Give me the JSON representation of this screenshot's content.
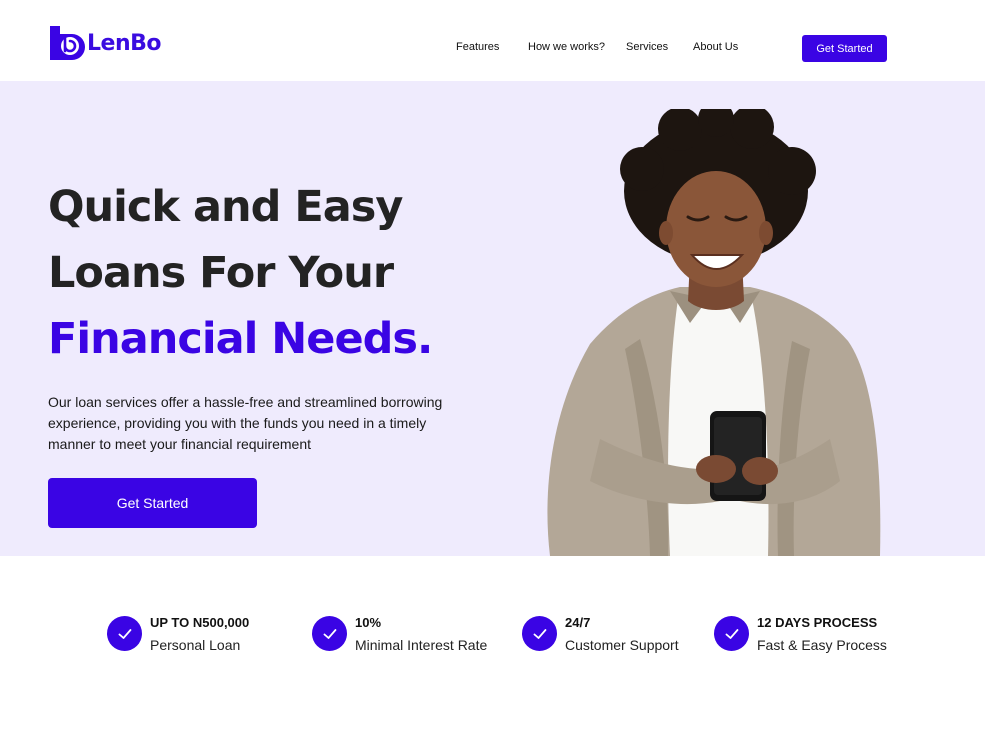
{
  "brand": {
    "name": "LenBo",
    "color": "#3a04e4"
  },
  "nav": {
    "items": [
      "Features",
      "How we works?",
      "Services",
      "About Us"
    ],
    "cta_label": "Get Started"
  },
  "hero": {
    "headline_line1": "Quick and Easy",
    "headline_line2": "Loans For Your",
    "headline_line3": "Financial Needs.",
    "description": "Our loan services offer a hassle-free and streamlined borrowing experience, providing you with the funds you need in a timely manner to meet your financial requirement",
    "cta_label": "Get Started",
    "background": "#efebfd"
  },
  "stats": [
    {
      "title": "UP TO N500,000",
      "subtitle": "Personal Loan",
      "icon": "check-circle-icon"
    },
    {
      "title": "10%",
      "subtitle": "Minimal Interest Rate",
      "icon": "check-circle-icon"
    },
    {
      "title": "24/7",
      "subtitle": "Customer Support",
      "icon": "check-circle-icon"
    },
    {
      "title": "12 DAYS PROCESS",
      "subtitle": "Fast & Easy Process",
      "icon": "check-circle-icon"
    }
  ]
}
